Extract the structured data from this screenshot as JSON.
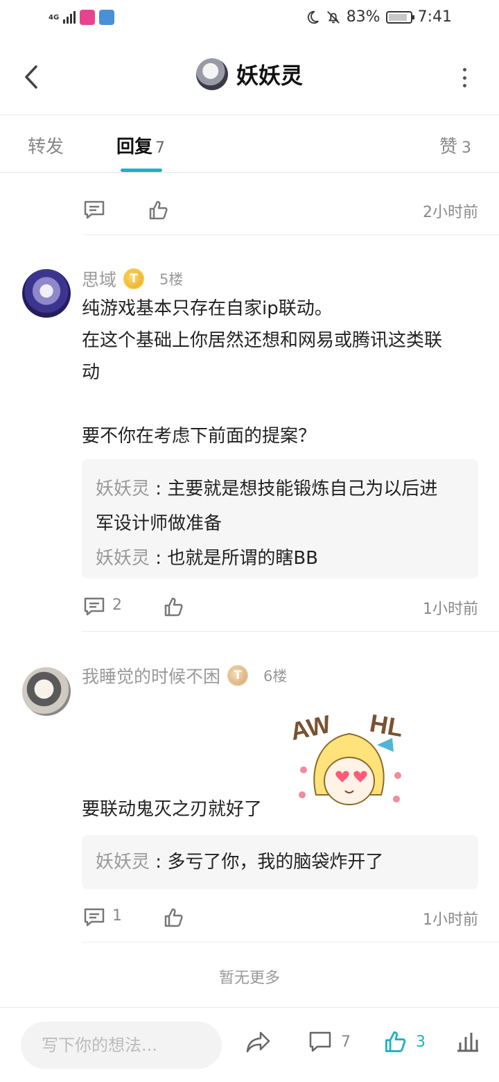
{
  "status_bar": {
    "network": "4G",
    "battery": "83%",
    "time": "7:41"
  },
  "header": {
    "title": "妖妖灵"
  },
  "tabs": [
    {
      "label": "转发",
      "count": ""
    },
    {
      "label": "回复",
      "count": "7"
    },
    {
      "label": "赞",
      "count": "3"
    }
  ],
  "top_actions": {
    "time": "2小时前"
  },
  "posts": [
    {
      "author": "思域",
      "badge": "T",
      "floor": "5楼",
      "body": [
        "纯游戏基本只存在自家ip联动。",
        "在这个基础上你居然还想和网易或腾讯这类联",
        "动",
        "",
        "要不你在考虑下前面的提案？"
      ],
      "quotes": [
        {
          "name": "妖妖灵",
          "sep": " : ",
          "text": "主要就是想技能锻炼自己为以后进",
          "text2": "军设计师做准备"
        },
        {
          "name": "妖妖灵",
          "sep": " : ",
          "text": "也就是所谓的瞎BB",
          "text2": ""
        }
      ],
      "comments": "2",
      "time": "1小时前"
    },
    {
      "author": "我睡觉的时候不困",
      "badge": "T",
      "floor": "6楼",
      "body": [
        "要联动鬼灭之刃就好了"
      ],
      "sticker_text": "AW HL",
      "quotes": [
        {
          "name": "妖妖灵",
          "sep": " : ",
          "text": "多亏了你，我的脑袋炸开了",
          "text2": ""
        }
      ],
      "comments": "1",
      "time": "1小时前"
    }
  ],
  "no_more": "暂无更多",
  "bottom_bar": {
    "input_placeholder": "写下你的想法...",
    "comment_count": "7",
    "like_count": "3"
  },
  "colors": {
    "accent": "#1fb0c4",
    "muted_text": "#999999",
    "quote_bg": "#f6f6f6"
  }
}
